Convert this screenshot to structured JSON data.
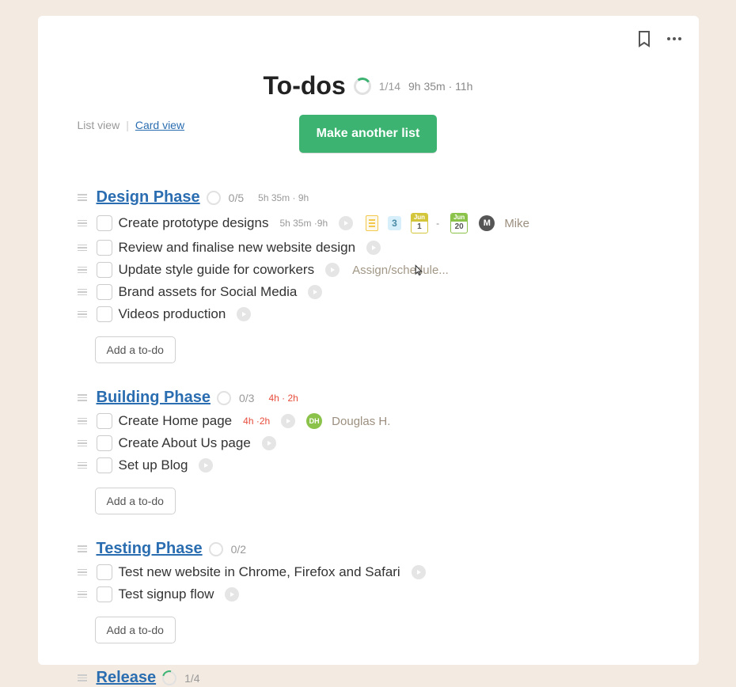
{
  "header": {
    "title": "To-dos",
    "count": "1/14",
    "time": "9h 35m · 11h",
    "make_btn": "Make another list"
  },
  "views": {
    "list": "List view",
    "card": "Card view"
  },
  "add_todo_label": "Add a to-do",
  "assign_prompt": "Assign/schedule...",
  "lists": [
    {
      "title": "Design Phase",
      "count": "0/5",
      "time": "5h 35m · 9h",
      "time_red": false,
      "todos": [
        {
          "text": "Create prototype designs",
          "time": "5h 35m ·9h",
          "has_doc": true,
          "badge": "3",
          "date_from": {
            "m": "Jun",
            "d": "1"
          },
          "date_to": {
            "m": "Jun",
            "d": "20"
          },
          "avatar": {
            "initial": "M",
            "color": "dark"
          },
          "assignee": "Mike"
        },
        {
          "text": "Review and finalise new website design"
        },
        {
          "text": "Update style guide for coworkers",
          "show_assign_prompt": true
        },
        {
          "text": "Brand assets for Social Media"
        },
        {
          "text": "Videos production"
        }
      ]
    },
    {
      "title": "Building Phase",
      "count": "0/3",
      "time": "4h · 2h",
      "time_red": true,
      "todos": [
        {
          "text": "Create Home page",
          "time": "4h ·2h",
          "time_red": true,
          "avatar": {
            "initial": "DH",
            "color": "green"
          },
          "assignee": "Douglas H."
        },
        {
          "text": "Create About Us page"
        },
        {
          "text": "Set up Blog"
        }
      ]
    },
    {
      "title": "Testing Phase",
      "count": "0/2",
      "todos": [
        {
          "text": "Test new website in Chrome, Firefox and Safari"
        },
        {
          "text": "Test signup flow"
        }
      ]
    }
  ],
  "release": {
    "title": "Release",
    "count": "1/4"
  }
}
